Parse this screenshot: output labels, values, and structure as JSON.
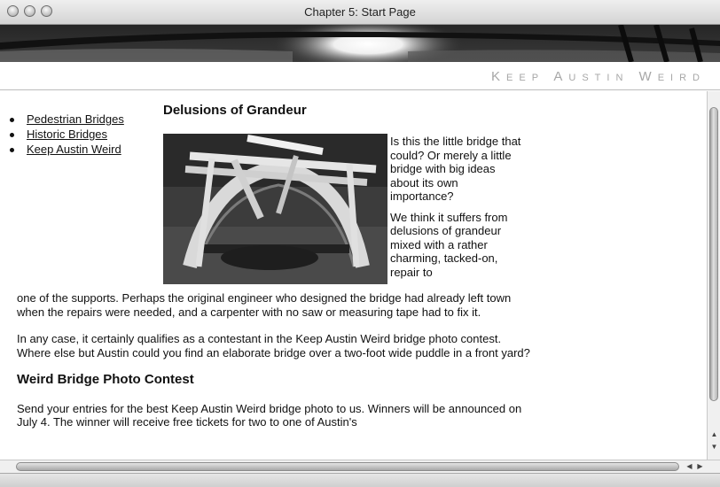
{
  "window": {
    "title": "Chapter 5: Start Page"
  },
  "header": {
    "brand": "Keep Austin Weird"
  },
  "sidebar": {
    "links": [
      {
        "label": "Pedestrian Bridges"
      },
      {
        "label": "Historic Bridges"
      },
      {
        "label": "Keep Austin Weird"
      }
    ]
  },
  "article": {
    "heading": "Delusions of Grandeur",
    "side_paragraph_1": "Is this the little bridge that could? Or merely a little bridge with big ideas about its own importance?",
    "side_paragraph_2": "We think it suffers from delusions of grandeur mixed with a rather charming, tacked-on, repair to",
    "wrap_paragraph": "one of the supports. Perhaps the original engineer who designed the bridge had already left town when the repairs were needed, and a carpenter with no saw or measuring tape had to fix it.",
    "paragraph_2": "In any case, it certainly qualifies as a contestant in the Keep Austin Weird bridge photo contest. Where else but Austin could you find an elaborate bridge over a two-foot wide puddle in a front yard?",
    "contest_heading": "Weird Bridge Photo Contest",
    "contest_paragraph": "Send your entries for the best Keep Austin Weird bridge photo to us. Winners will be announced on July 4. The winner will receive free tickets for two to one of Austin's"
  }
}
